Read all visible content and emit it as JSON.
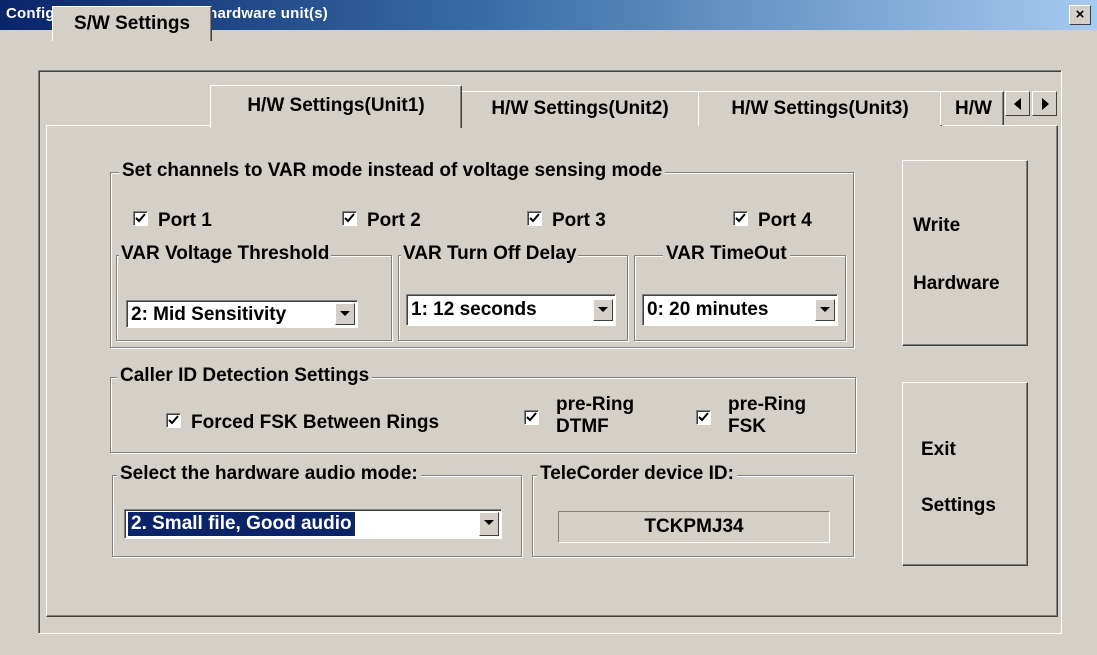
{
  "window": {
    "title": "Configure Software, and/or hardware unit(s)",
    "close_label": "×"
  },
  "tabs": [
    "S/W Settings",
    "H/W Settings(Unit1)",
    "H/W Settings(Unit2)",
    "H/W Settings(Unit3)",
    "H/W"
  ],
  "active_tab": 1,
  "var_group": {
    "legend": "Set channels to VAR mode instead of voltage sensing mode",
    "ports": [
      {
        "label": "Port 1",
        "checked": true
      },
      {
        "label": "Port 2",
        "checked": true
      },
      {
        "label": "Port 3",
        "checked": true
      },
      {
        "label": "Port 4",
        "checked": true
      }
    ],
    "threshold": {
      "legend": "VAR Voltage Threshold",
      "value": "2: Mid Sensitivity"
    },
    "turnoff": {
      "legend": "VAR Turn Off Delay",
      "value": "1: 12 seconds"
    },
    "timeout": {
      "legend": "VAR TimeOut",
      "value": "0: 20 minutes"
    }
  },
  "caller_id": {
    "legend": "Caller ID Detection Settings",
    "forced_fsk": {
      "label": "Forced FSK Between Rings",
      "checked": true
    },
    "pre_ring_dtmf": {
      "label_1": "pre-Ring",
      "label_2": "DTMF",
      "checked": true
    },
    "pre_ring_fsk": {
      "label_1": "pre-Ring",
      "label_2": "FSK",
      "checked": true
    }
  },
  "audio_mode": {
    "legend": "Select the hardware audio mode:",
    "value": "2. Small file, Good audio"
  },
  "device_id": {
    "legend": "TeleCorder device ID:",
    "value": "TCKPMJ34"
  },
  "buttons": {
    "write": {
      "line1": "Write",
      "line2": "Hardware"
    },
    "exit": {
      "line1": "Exit",
      "line2": "Settings"
    }
  }
}
